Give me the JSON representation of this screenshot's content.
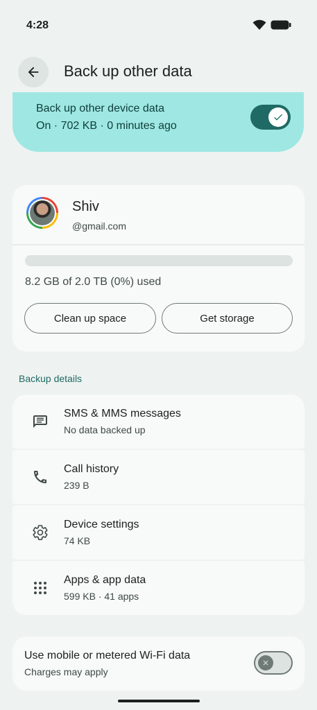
{
  "status_bar": {
    "time": "4:28",
    "icons": [
      "wifi-icon",
      "battery-icon"
    ]
  },
  "header": {
    "back_icon": "arrow-left-icon",
    "title": "Back up other data"
  },
  "main_toggle": {
    "title": "Back up other device data",
    "subtitle": "On · 702 KB · 0 minutes ago",
    "state": "on",
    "accent": "#1f6a64",
    "card_color": "#9ee7e2"
  },
  "account": {
    "name": "Shiv",
    "email": "@gmail.com",
    "storage_used_fraction": 0,
    "storage_text": "8.2 GB of 2.0 TB (0%) used",
    "clean_up_label": "Clean up space",
    "get_storage_label": "Get storage"
  },
  "backup_details": {
    "label": "Backup details",
    "items": [
      {
        "icon": "message-icon",
        "title": "SMS & MMS messages",
        "subtitle": "No data backed up"
      },
      {
        "icon": "phone-icon",
        "title": "Call history",
        "subtitle": "239 B"
      },
      {
        "icon": "gear-icon",
        "title": "Device settings",
        "subtitle": "74 KB"
      },
      {
        "icon": "apps-grid-icon",
        "title": "Apps & app data",
        "subtitle": "599 KB · 41 apps"
      }
    ]
  },
  "mobile_data": {
    "title": "Use mobile or metered Wi-Fi data",
    "subtitle": "Charges may apply",
    "state": "off"
  }
}
